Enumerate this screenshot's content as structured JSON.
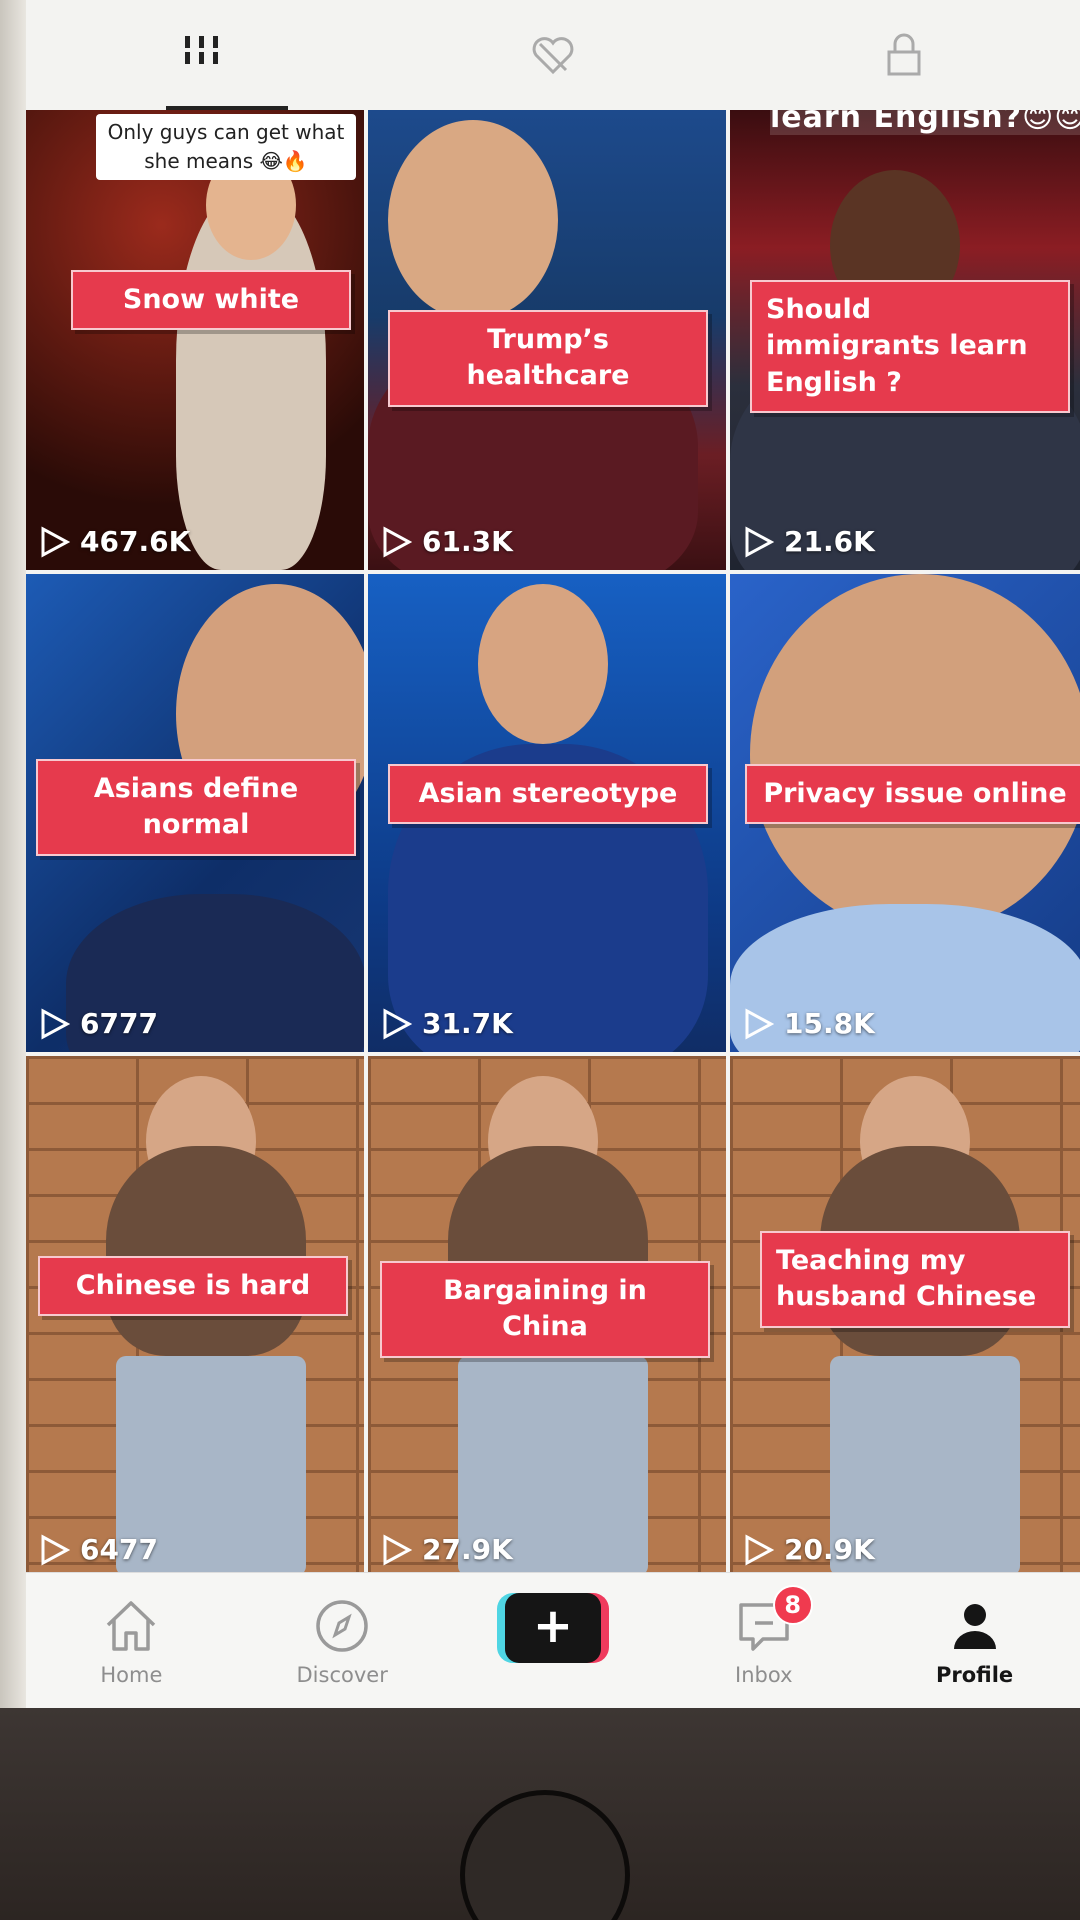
{
  "top_tabs": {
    "items": [
      {
        "icon": "grid-icon"
      },
      {
        "icon": "liked-icon"
      },
      {
        "icon": "lock-icon"
      }
    ]
  },
  "videos": [
    {
      "caption": "Snow white",
      "views": "467.6K",
      "overlay_text": "Only guys can get what she means 😂🔥"
    },
    {
      "caption": "Trump’s healthcare",
      "views": "61.3K"
    },
    {
      "caption": "Should immigrants learn English ?",
      "views": "21.6K",
      "overlay_text": "learn English?😊😊"
    },
    {
      "caption": "Asians define normal",
      "views": "6777"
    },
    {
      "caption": "Asian stereotype",
      "views": "31.7K"
    },
    {
      "caption": "Privacy issue online",
      "views": "15.8K"
    },
    {
      "caption": "Chinese is hard",
      "views": "6477"
    },
    {
      "caption": "Bargaining in China",
      "views": "27.9K"
    },
    {
      "caption": "Teaching my husband Chinese",
      "views": "20.9K"
    }
  ],
  "bottom_nav": {
    "home": "Home",
    "discover": "Discover",
    "create": "+",
    "inbox": "Inbox",
    "inbox_badge": "8",
    "profile": "Profile"
  },
  "colors": {
    "caption_red": "#e63a4d",
    "badge_red": "#f03a4f",
    "create_cyan": "#4fd5e3",
    "create_pink": "#ef3a5d"
  }
}
